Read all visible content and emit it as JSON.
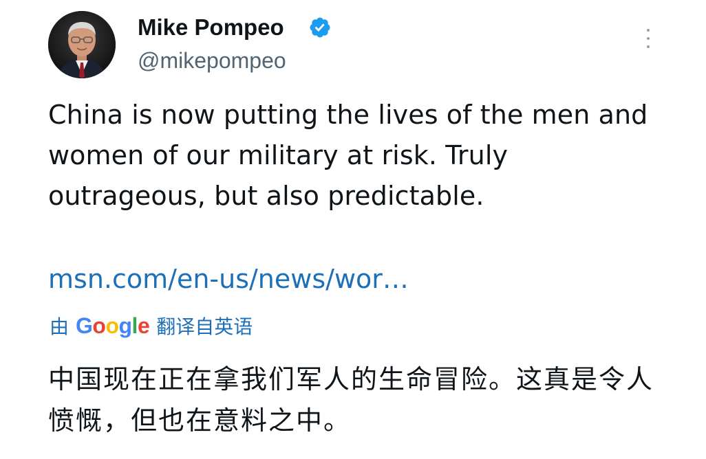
{
  "author": {
    "display_name": "Mike Pompeo",
    "handle": "@mikepompeo",
    "verified": true
  },
  "tweet": {
    "text": "China is now putting the lives of the men and women of our military at risk. Truly outrageous, but also predictable.",
    "link": "msn.com/en-us/news/wor…"
  },
  "translation": {
    "by_label": "由",
    "google_logo": [
      "G",
      "o",
      "o",
      "g",
      "l",
      "e"
    ],
    "suffix": "翻译自英语",
    "text": "中国现在正在拿我们军人的生命冒险。这真是令人愤慨，但也在意料之中。"
  },
  "icons": {
    "verified": "verified-badge-icon",
    "more": "more-vertical-icon"
  },
  "colors": {
    "text_primary": "#0f1419",
    "text_secondary": "#536471",
    "link": "#1d6fb8",
    "verified": "#1d9bf0",
    "google_blue": "#4285f4",
    "google_red": "#ea4335",
    "google_yellow": "#fbbc05",
    "google_green": "#34a853"
  }
}
